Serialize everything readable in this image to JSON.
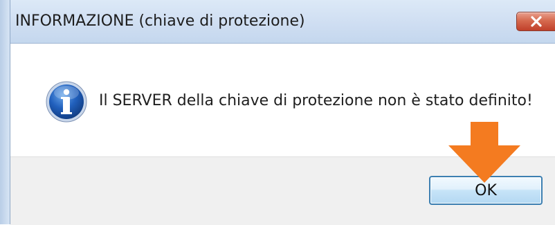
{
  "window": {
    "title": "INFORMAZIONE (chiave di protezione)",
    "close_icon": "close-icon"
  },
  "dialog": {
    "icon": "info-icon",
    "message": "Il SERVER della chiave di protezione non è stato definito!",
    "ok_label": "OK"
  },
  "annotation": {
    "arrow_icon": "arrow-down-icon",
    "arrow_color": "#f47b20"
  },
  "colors": {
    "close_button": "#c9503a",
    "ok_border": "#3c7fb1",
    "info_icon_blue": "#1b4fa0"
  }
}
